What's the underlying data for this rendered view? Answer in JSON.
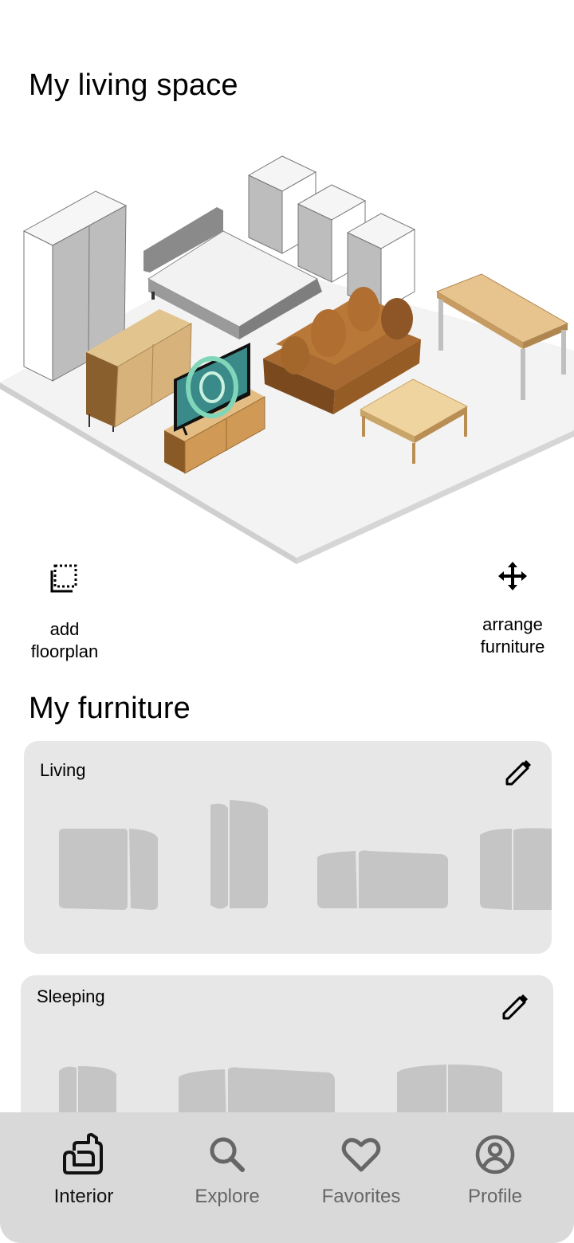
{
  "living_space": {
    "title": "My living space",
    "actions": {
      "add_floorplan": {
        "line1": "add",
        "line2": "floorplan",
        "icon": "floorplan-add-icon"
      },
      "arrange_furniture": {
        "line1": "arrange",
        "line2": "furniture",
        "icon": "move-arrows-icon"
      }
    }
  },
  "furniture": {
    "title": "My furniture",
    "categories": [
      {
        "label": "Living",
        "edit_icon": "pencil-icon"
      },
      {
        "label": "Sleeping",
        "edit_icon": "pencil-icon"
      }
    ]
  },
  "tabbar": {
    "tabs": [
      {
        "label": "Interior",
        "icon": "sofa-icon",
        "active": true
      },
      {
        "label": "Explore",
        "icon": "search-icon",
        "active": false
      },
      {
        "label": "Favorites",
        "icon": "heart-icon",
        "active": false
      },
      {
        "label": "Profile",
        "icon": "user-circle-icon",
        "active": false
      }
    ]
  },
  "colors": {
    "card_bg": "#e7e7e7",
    "tabbar_bg": "#d9d9d9",
    "placeholder": "#c5c5c5",
    "inactive_tab": "#666666"
  }
}
